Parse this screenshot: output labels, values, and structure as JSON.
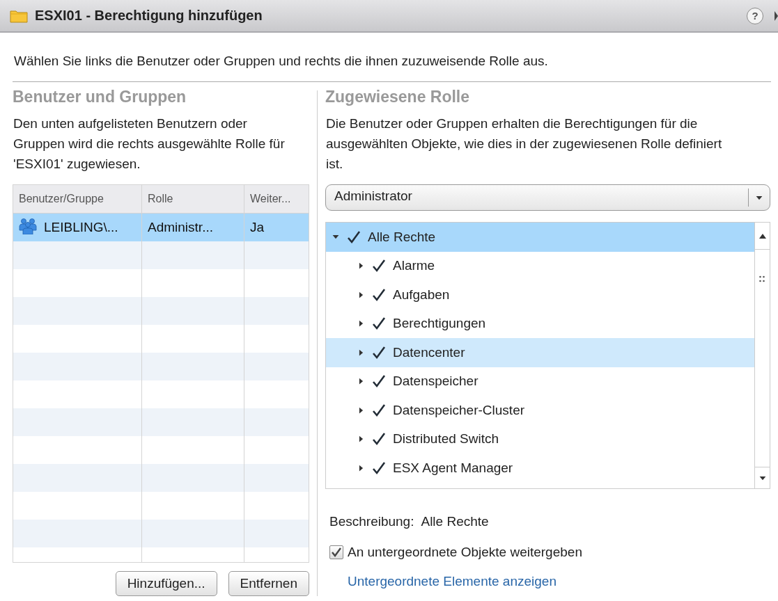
{
  "window": {
    "title": "ESXI01 - Berechtigung hinzufügen",
    "help": "?"
  },
  "instructions": "Wählen Sie links die Benutzer oder Gruppen und rechts die ihnen zuzuweisende Rolle aus.",
  "left": {
    "heading": "Benutzer und Gruppen",
    "description": "Den unten aufgelisteten Benutzern oder Gruppen wird die rechts ausgewählte Rolle für 'ESXI01' zugewiesen.",
    "table": {
      "columns": [
        "Benutzer/Gruppe",
        "Rolle",
        "Weiter..."
      ],
      "rows": [
        {
          "cells": [
            "LEIBLING\\...",
            "Administr...",
            "Ja"
          ],
          "selected": true
        }
      ]
    },
    "buttons": [
      "Hinzufügen...",
      "Entfernen"
    ]
  },
  "right": {
    "heading": "Zugewiesene Rolle",
    "description": "Die Benutzer oder Gruppen erhalten die Berechtigungen für die ausgewählten Objekte, wie dies in der zugewiesenen Rolle definiert ist.",
    "role_select": {
      "value": "Administrator"
    },
    "privileges": [
      {
        "label": "Alle Rechte",
        "checked": true,
        "expanded": true,
        "selected": true,
        "highlighted": false,
        "children": [
          {
            "label": "Alarme",
            "checked": true,
            "expanded": false,
            "selected": false,
            "highlighted": false
          },
          {
            "label": "Aufgaben",
            "checked": true,
            "expanded": false,
            "selected": false,
            "highlighted": false
          },
          {
            "label": "Berechtigungen",
            "checked": true,
            "expanded": false,
            "selected": false,
            "highlighted": false
          },
          {
            "label": "Datencenter",
            "checked": true,
            "expanded": false,
            "selected": false,
            "highlighted": true
          },
          {
            "label": "Datenspeicher",
            "checked": true,
            "expanded": false,
            "selected": false,
            "highlighted": false
          },
          {
            "label": "Datenspeicher-Cluster",
            "checked": true,
            "expanded": false,
            "selected": false,
            "highlighted": false
          },
          {
            "label": "Distributed Switch",
            "checked": true,
            "expanded": false,
            "selected": false,
            "highlighted": false
          },
          {
            "label": "ESX Agent Manager",
            "checked": true,
            "expanded": false,
            "selected": false,
            "highlighted": false
          }
        ]
      }
    ],
    "description_label": "Beschreibung:",
    "description_value": "Alle Rechte",
    "propagate": {
      "label": "An untergeordnete Objekte weitergeben",
      "checked": true
    },
    "link": "Untergeordnete Elemente anzeigen"
  }
}
